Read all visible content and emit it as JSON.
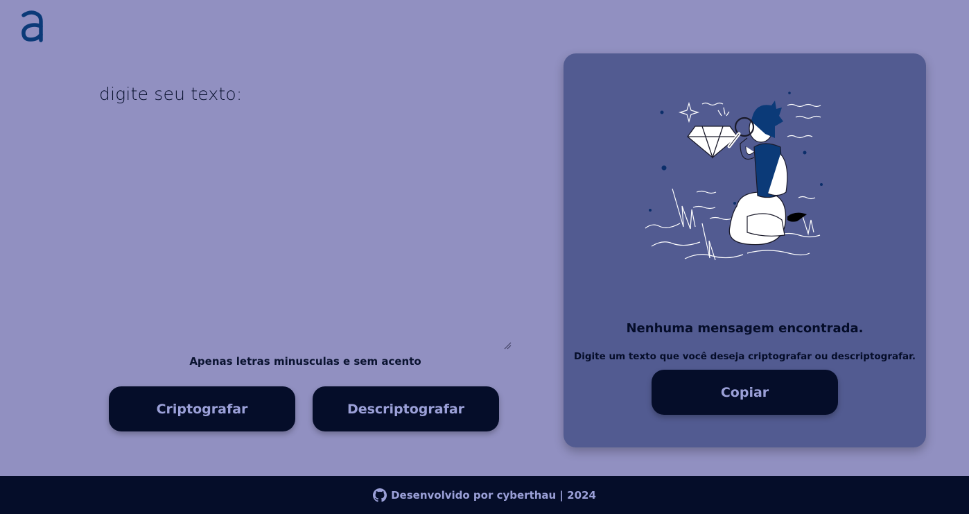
{
  "brand": {
    "logo_icon": "letter-a-logo-icon",
    "color": "#0b3a78"
  },
  "input": {
    "label": "digite seu texto:",
    "value": "",
    "hint": "Apenas letras minusculas e sem acento"
  },
  "actions": {
    "encrypt_label": "Criptografar",
    "decrypt_label": "Descriptografar"
  },
  "output": {
    "illustration_icon": "person-with-magnifier-illustration",
    "title": "Nenhuma mensagem encontrada.",
    "subtitle": "Digite um texto que você deseja criptografar ou descriptografar.",
    "copy_label": "Copiar"
  },
  "footer": {
    "icon": "github-icon",
    "text": "Desenvolvido por cyberthau | 2024"
  },
  "colors": {
    "background": "#9190c1",
    "card": "#525b91",
    "button": "#050d29",
    "button_text": "#9ba0d8",
    "footer": "#050d29"
  }
}
